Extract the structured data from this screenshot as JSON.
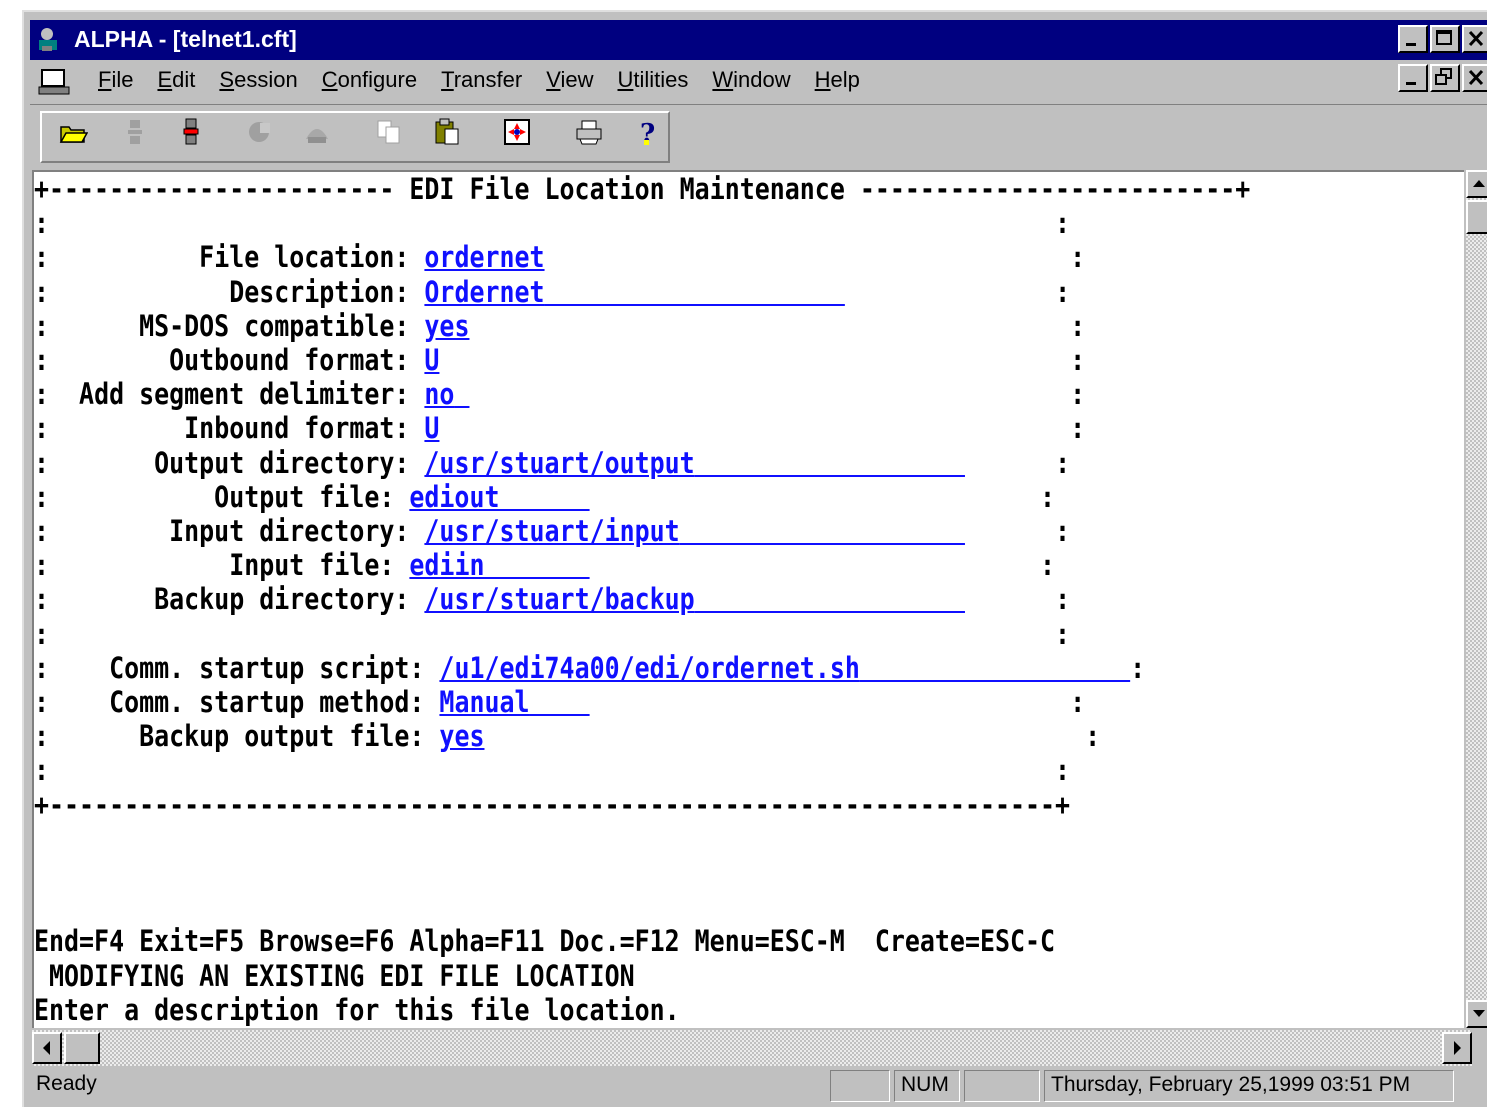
{
  "window": {
    "title": "ALPHA - [telnet1.cft]"
  },
  "menu": [
    {
      "accel": "F",
      "rest": "ile"
    },
    {
      "accel": "E",
      "rest": "dit"
    },
    {
      "accel": "S",
      "rest": "ession"
    },
    {
      "accel": "C",
      "rest": "onfigure"
    },
    {
      "accel": "T",
      "rest": "ransfer"
    },
    {
      "accel": "V",
      "rest": "iew"
    },
    {
      "accel": "U",
      "rest": "tilities"
    },
    {
      "accel": "W",
      "rest": "indow"
    },
    {
      "accel": "H",
      "rest": "elp"
    }
  ],
  "toolbar_icons": [
    "open-folder-icon",
    "disconnect-icon",
    "connect-icon",
    "capture-icon",
    "phonebook-icon",
    "copy-icon",
    "paste-icon",
    "settings-icon",
    "print-icon",
    "help-icon"
  ],
  "terminal": {
    "box_title": "EDI File Location Maintenance",
    "fields": {
      "file_location": {
        "label": "File location:",
        "value": "ordernet"
      },
      "description": {
        "label": "Description:",
        "value": "Ordernet"
      },
      "ms_dos": {
        "label": "MS-DOS compatible:",
        "value": "yes"
      },
      "outbound_format": {
        "label": "Outbound format:",
        "value": "U"
      },
      "add_segment_delimiter": {
        "label": "Add segment delimiter:",
        "value": "no"
      },
      "inbound_format": {
        "label": "Inbound format:",
        "value": "U"
      },
      "output_directory": {
        "label": "Output directory:",
        "value": "/usr/stuart/output"
      },
      "output_file": {
        "label": "Output file:",
        "value": "ediout"
      },
      "input_directory": {
        "label": "Input directory:",
        "value": "/usr/stuart/input"
      },
      "input_file": {
        "label": "Input file:",
        "value": "ediin"
      },
      "backup_directory": {
        "label": "Backup directory:",
        "value": "/usr/stuart/backup"
      },
      "comm_startup_script": {
        "label": "Comm. startup script:",
        "value": "/u1/edi74a00/edi/ordernet.sh"
      },
      "comm_startup_method": {
        "label": "Comm. startup method:",
        "value": "Manual"
      },
      "backup_output_file": {
        "label": "Backup output file:",
        "value": "yes"
      }
    },
    "function_keys": "End=F4 Exit=F5 Browse=F6 Alpha=F11 Doc.=F12 Menu=ESC-M  Create=ESC-C",
    "mode_line": " MODIFYING AN EXISTING EDI FILE LOCATION",
    "prompt_line": "Enter a description for this file location."
  },
  "status": {
    "ready": "Ready",
    "num": "NUM",
    "datetime": "Thursday, February 25,1999  03:51 PM"
  }
}
